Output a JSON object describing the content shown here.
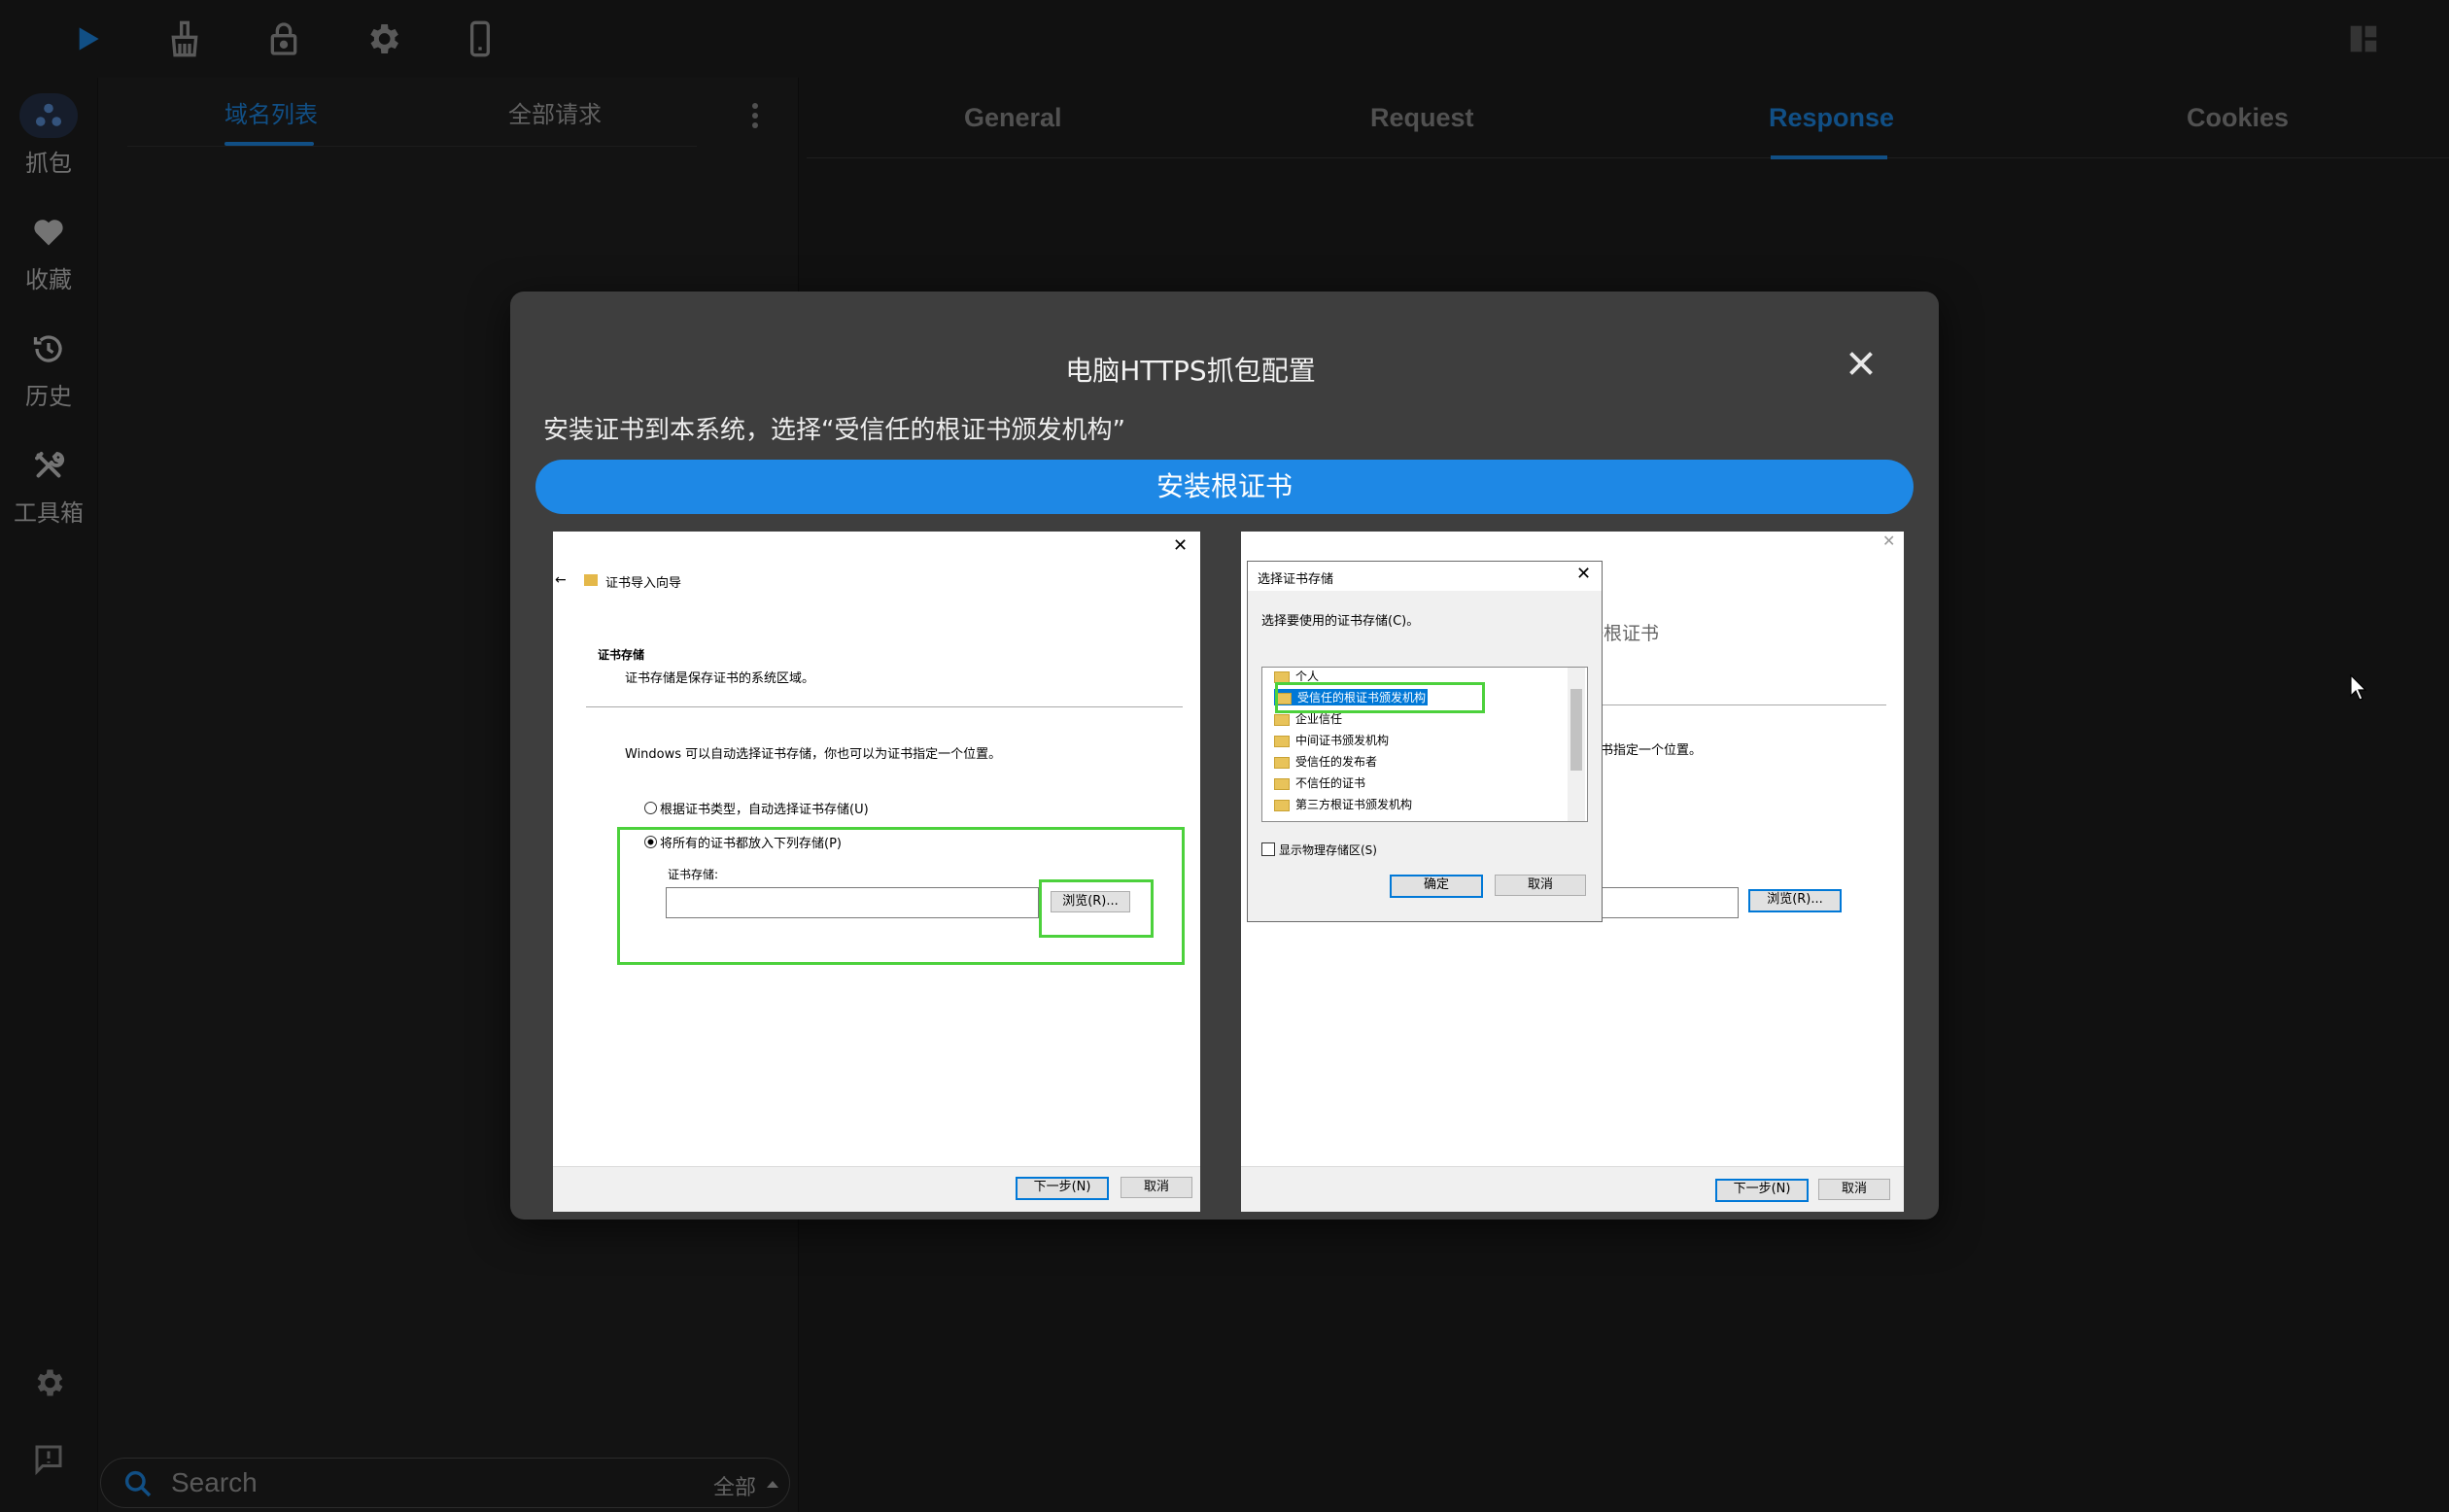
{
  "toolbar": {
    "icons": [
      "play-icon",
      "broom-icon",
      "lock-icon",
      "gear-icon",
      "phone-icon",
      "layout-icon"
    ],
    "accent": "#1e88e5"
  },
  "leftnav": {
    "items": [
      {
        "label": "抓包",
        "icon": "capture-icon"
      },
      {
        "label": "收藏",
        "icon": "heart-icon"
      },
      {
        "label": "历史",
        "icon": "history-icon"
      },
      {
        "label": "工具箱",
        "icon": "tools-icon"
      }
    ]
  },
  "list_panel": {
    "tabs": [
      "域名列表",
      "全部请求"
    ],
    "search_placeholder": "Search",
    "filter_label": "全部"
  },
  "detail": {
    "tabs": [
      "General",
      "Request",
      "Response",
      "Cookies"
    ],
    "active_tab": "Response"
  },
  "modal": {
    "title": "电脑HTTPS抓包配置",
    "instruction": "安装证书到本系统，选择“受信任的根证书颁发机构”",
    "install_button": "安装根证书",
    "left_image": {
      "wizard_title": "证书导入向导",
      "section_title": "证书存储",
      "section_desc": "证书存储是保存证书的系统区域。",
      "body_text": "Windows 可以自动选择证书存储，你也可以为证书指定一个位置。",
      "radio_auto": "根据证书类型，自动选择证书存储(U)",
      "radio_manual": "将所有的证书都放入下列存储(P)",
      "store_label": "证书存储:",
      "browse_button": "浏览(R)...",
      "next_button": "下一步(N)",
      "cancel_button": "取消"
    },
    "right_image": {
      "dialog_title": "选择证书存储",
      "dialog_prompt": "选择要使用的证书存储(C)。",
      "annotation": "此处必须选择受信任根证书",
      "stores": [
        "个人",
        "受信任的根证书颁发机构",
        "企业信任",
        "中间证书颁发机构",
        "受信任的发布者",
        "不信任的证书",
        "第三方根证书颁发机构"
      ],
      "show_physical": "显示物理存储区(S)",
      "ok_button": "确定",
      "cancel_button": "取消",
      "bg_text": "书指定一个位置。",
      "browse_button": "浏览(R)...",
      "next_button": "下一步(N)",
      "cancel2_button": "取消"
    }
  }
}
